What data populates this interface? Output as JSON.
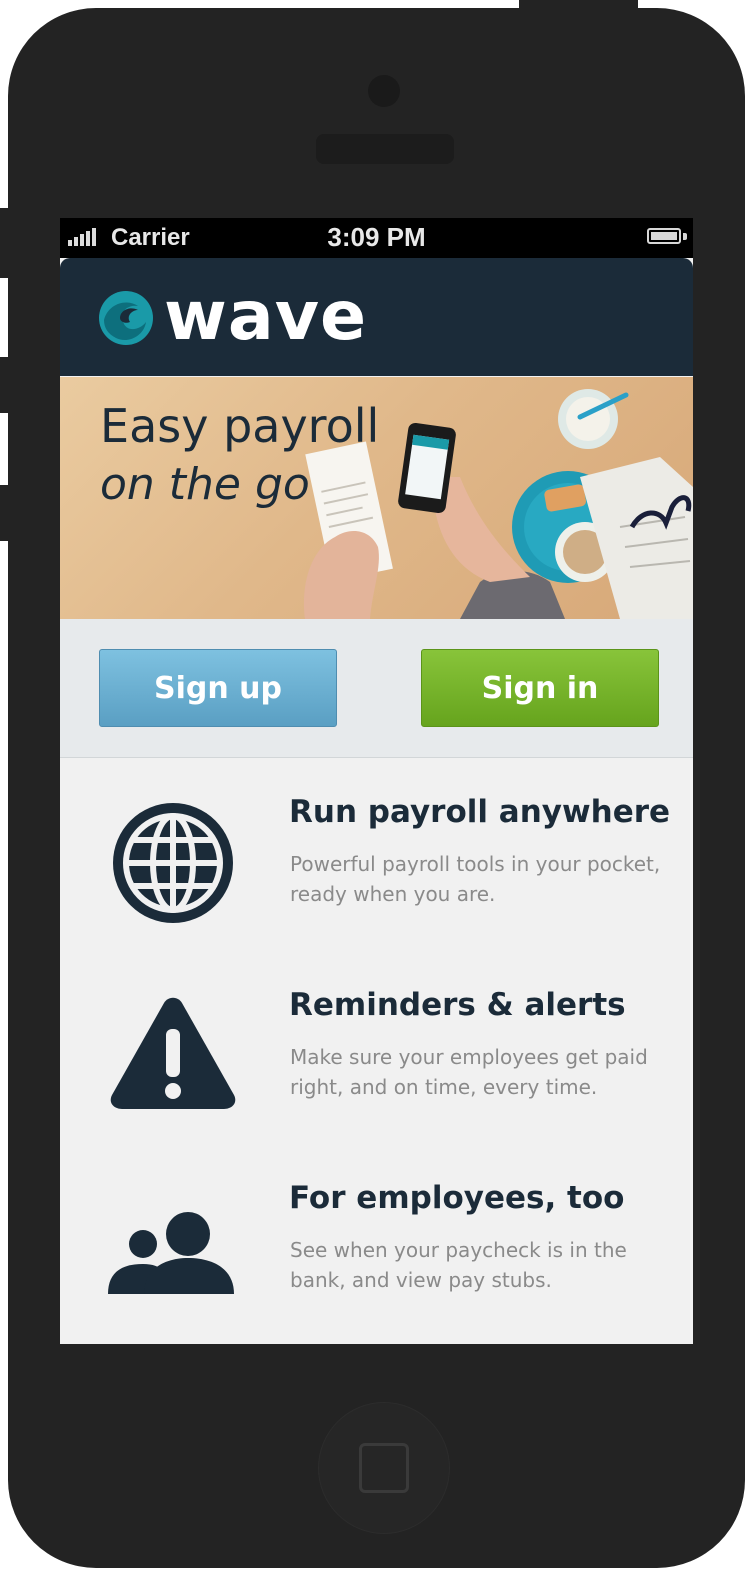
{
  "statusbar": {
    "carrier": "Carrier",
    "time": "3:09 PM"
  },
  "header": {
    "logo_text": "wave",
    "brand_color": "#1b2b39",
    "accent_color": "#1a9aa8"
  },
  "hero": {
    "line1": "Easy payroll",
    "line2": "on the go"
  },
  "actions": {
    "signup_label": "Sign up",
    "signin_label": "Sign in",
    "signup_color": "#6aaed1",
    "signin_color": "#77b52b"
  },
  "features": [
    {
      "icon": "globe-icon",
      "title": "Run payroll anywhere",
      "desc": "Powerful payroll tools in your pocket, ready when you are."
    },
    {
      "icon": "warning-icon",
      "title": "Reminders & alerts",
      "desc": "Make sure your employees get paid right, and on time, every time."
    },
    {
      "icon": "people-icon",
      "title": "For employees, too",
      "desc": "See when your paycheck is in the bank, and view pay stubs."
    }
  ]
}
